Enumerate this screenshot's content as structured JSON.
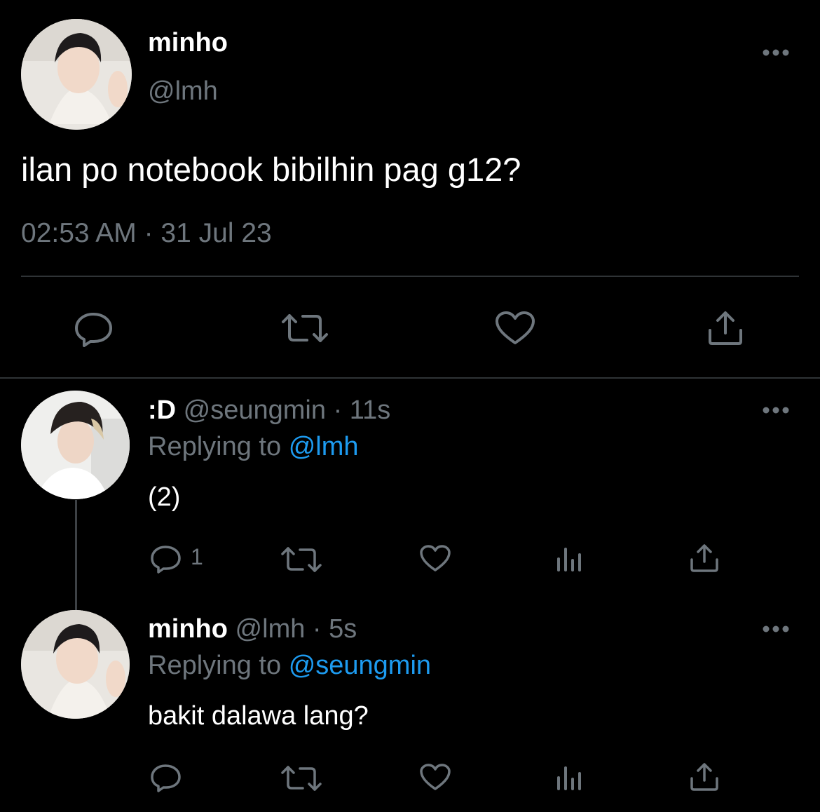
{
  "main_tweet": {
    "name": "minho",
    "handle": "@lmh",
    "text": "ilan po notebook bibilhin pag g12?",
    "timestamp": "02:53 AM · 31 Jul 23"
  },
  "replies": [
    {
      "name": ":D",
      "handle": "@seungmin",
      "time": "· 11s",
      "replying_prefix": "Replying to",
      "replying_to": "@lmh",
      "text": "(2)",
      "reply_count": "1"
    },
    {
      "name": "minho",
      "handle": "@lmh",
      "time": "· 5s",
      "replying_prefix": "Replying to",
      "replying_to": "@seungmin",
      "text": "bakit dalawa lang?",
      "reply_count": ""
    }
  ],
  "icons": {
    "reply": "reply-bubble-icon",
    "retweet": "retweet-icon",
    "like": "heart-icon",
    "share": "share-icon",
    "analytics": "analytics-icon",
    "more": "more-dots-icon"
  },
  "colors": {
    "background": "#000000",
    "text": "#ffffff",
    "muted": "#6e767d",
    "link": "#1d9bf0",
    "divider": "#2f3336"
  }
}
